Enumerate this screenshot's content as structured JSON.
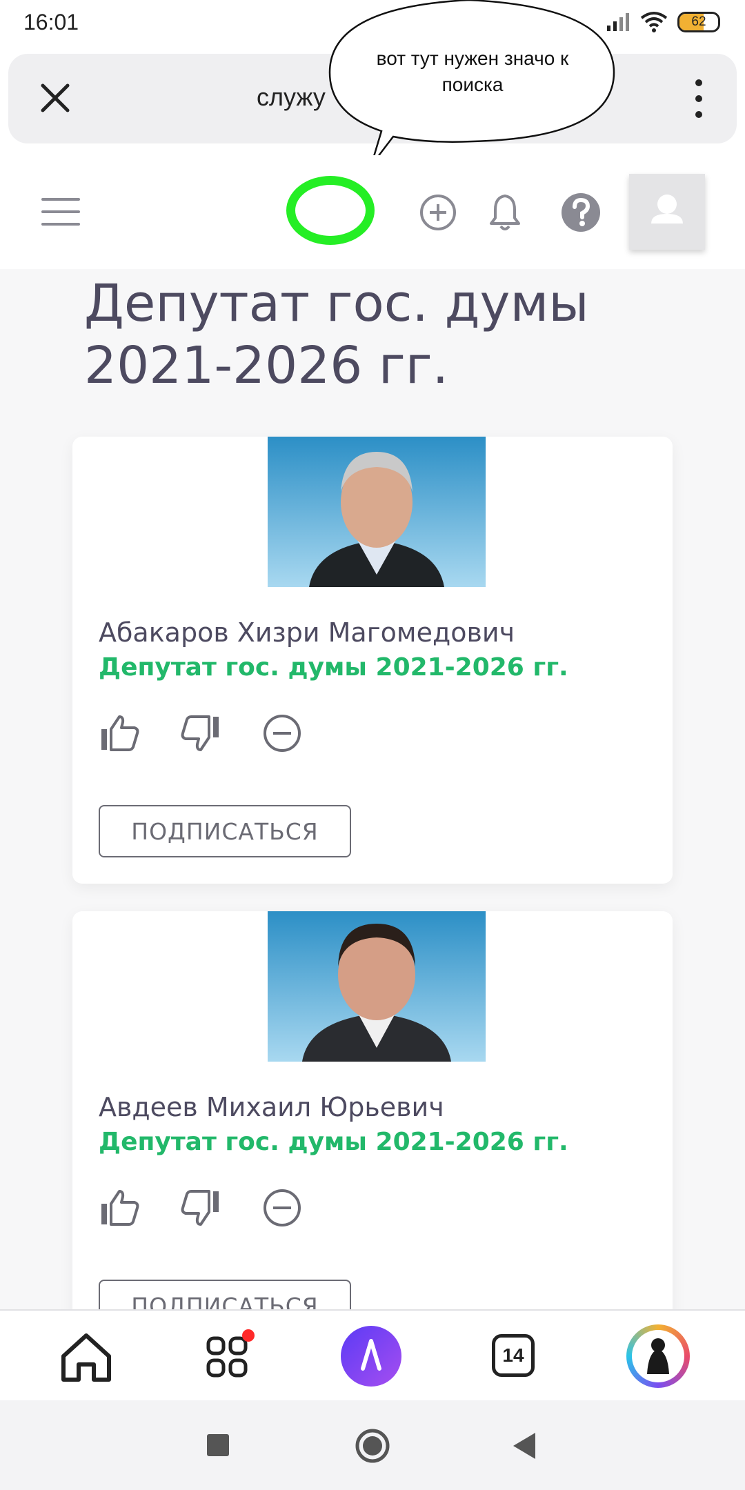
{
  "status_bar": {
    "time": "16:01",
    "battery_level": 62,
    "battery_label": "62",
    "icons": [
      "signal-icon",
      "wifi-icon",
      "battery-icon"
    ]
  },
  "browser": {
    "url_text": "служу",
    "close_icon": "close-icon",
    "menu_icon": "more-vert-icon"
  },
  "annotation": {
    "bubble_text": "вот тут нужен значо к поиска"
  },
  "header": {
    "icons": [
      "menu-icon",
      "search-highlight",
      "add-circle-icon",
      "bell-icon",
      "help-icon",
      "user-icon"
    ]
  },
  "page": {
    "title": "Депутат гос. думы 2021-2026 гг."
  },
  "cards": [
    {
      "name": "Абакаров Хизри Магомедович",
      "role": "Депутат гос. думы 2021-2026 гг.",
      "subscribe_label": "ПОДПИСАТЬСЯ"
    },
    {
      "name": "Авдеев Михаил Юрьевич",
      "role": "Депутат гос. думы 2021-2026 гг.",
      "subscribe_label": "ПОДПИСАТЬСЯ"
    }
  ],
  "bottom_nav": {
    "tabs_count": "14",
    "items": [
      "home-icon",
      "apps-icon",
      "alice-icon",
      "tabs-icon",
      "profile-avatar"
    ]
  },
  "colors": {
    "accent_green": "#22b86a",
    "search_ring": "#25ee25",
    "title": "#4d4a60",
    "notification_dot": "#ff2a2a"
  }
}
